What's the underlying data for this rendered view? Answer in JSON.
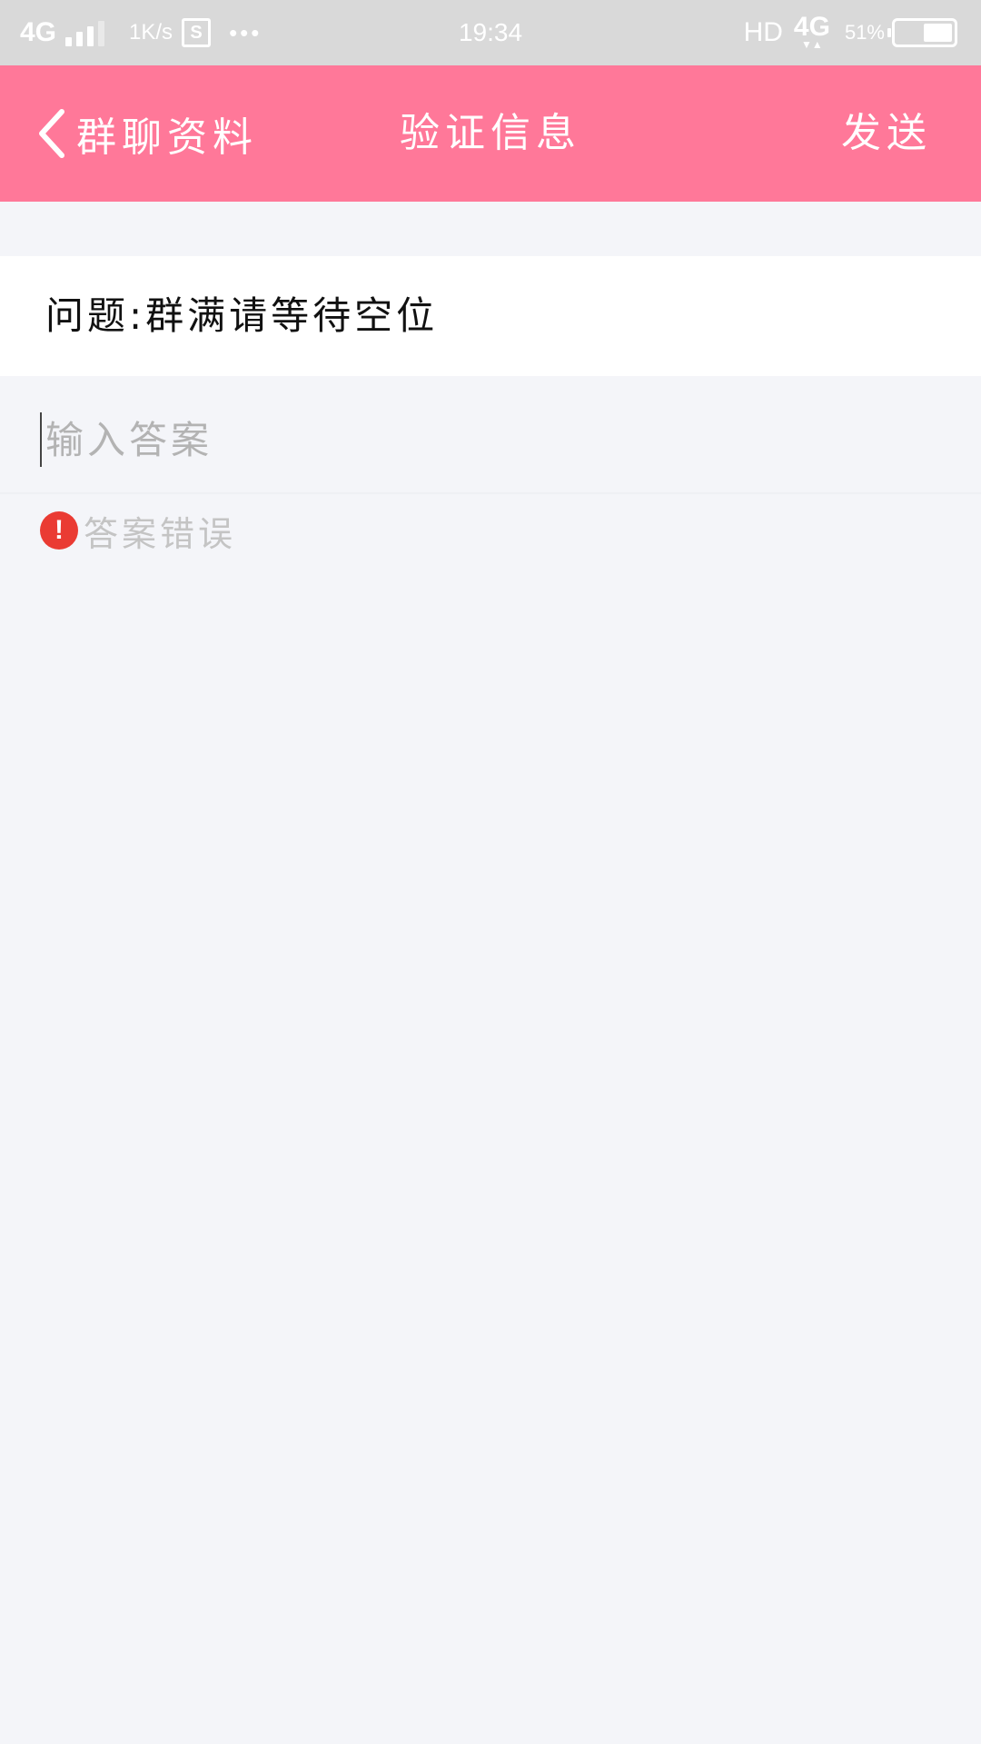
{
  "status_bar": {
    "network": "4G",
    "speed": "1K/s",
    "app_icon_letter": "S",
    "dots": "•••",
    "time": "19:34",
    "hd": "HD",
    "data_network": "4G",
    "data_arrows": "▼▲",
    "battery_percent_label": "51%",
    "battery_level": 51
  },
  "nav": {
    "back_label": "群聊资料",
    "title": "验证信息",
    "send_label": "发送"
  },
  "question": {
    "text": "问题:群满请等待空位"
  },
  "answer": {
    "placeholder": "输入答案",
    "value": ""
  },
  "error": {
    "icon_glyph": "!",
    "text": "答案错误"
  },
  "colors": {
    "nav_background": "#ff7899",
    "status_bar_background": "#d9d9d9",
    "page_background": "#f4f5f9",
    "error_red": "#ea3b33"
  }
}
